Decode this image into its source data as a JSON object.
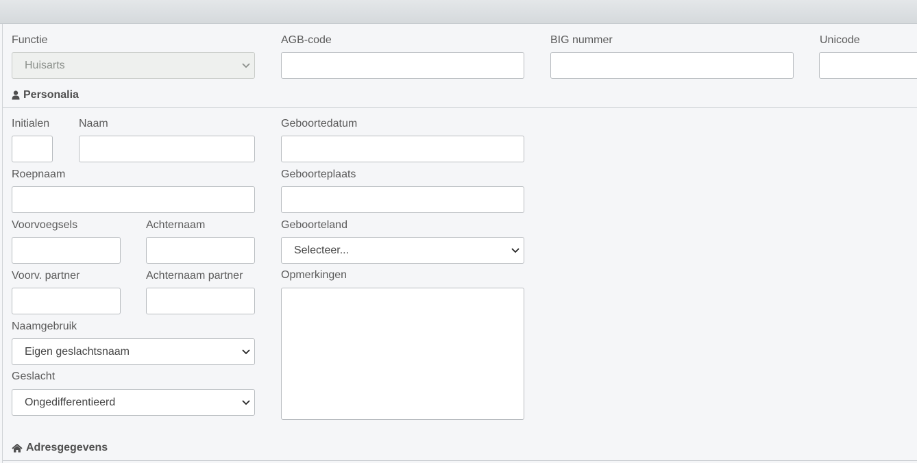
{
  "row1": {
    "functie_label": "Functie",
    "functie_value": "Huisarts",
    "agb_label": "AGB-code",
    "big_label": "BIG nummer",
    "unicode_label": "Unicode"
  },
  "sections": {
    "personalia": "Personalia",
    "adres": "Adresgegevens"
  },
  "personalia": {
    "initialen_label": "Initialen",
    "naam_label": "Naam",
    "geboortedatum_label": "Geboortedatum",
    "roepnaam_label": "Roepnaam",
    "geboorteplaats_label": "Geboorteplaats",
    "voorvoegsels_label": "Voorvoegsels",
    "achternaam_label": "Achternaam",
    "geboorteland_label": "Geboorteland",
    "geboorteland_value": "Selecteer...",
    "voorv_partner_label": "Voorv. partner",
    "achternaam_partner_label": "Achternaam partner",
    "opmerkingen_label": "Opmerkingen",
    "naamgebruik_label": "Naamgebruik",
    "naamgebruik_value": "Eigen geslachtsnaam",
    "geslacht_label": "Geslacht",
    "geslacht_value": "Ongedifferentieerd"
  },
  "icons": {
    "personalia": "user-icon",
    "adres": "home-icon",
    "select": "chevron-down-icon"
  }
}
